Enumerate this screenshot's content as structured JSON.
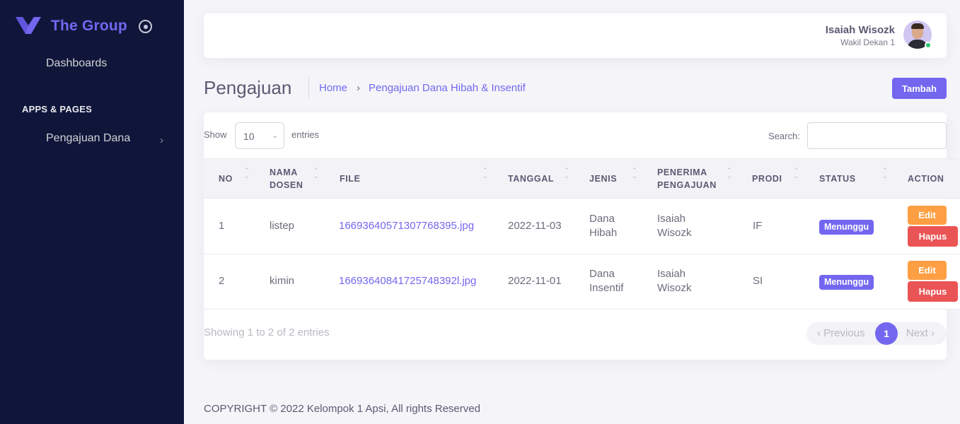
{
  "brand": {
    "name": "The Group",
    "color": "#7367f0"
  },
  "sidebar": {
    "dashboards": "Dashboards",
    "section": "APPS & PAGES",
    "pengajuan": "Pengajuan Dana"
  },
  "user": {
    "name": "Isaiah Wisozk",
    "role": "Wakil Dekan 1"
  },
  "page": {
    "title": "Pengajuan",
    "breadcrumb_home": "Home",
    "breadcrumb_sep": "›",
    "breadcrumb_current": "Pengajuan Dana Hibah & Insentif",
    "add_button": "Tambah"
  },
  "table_controls": {
    "show": "Show",
    "entries_value": "10",
    "entries": "entries",
    "search": "Search:"
  },
  "columns": {
    "no": "NO",
    "nama1": "NAMA",
    "nama2": "DOSEN",
    "file": "FILE",
    "tanggal": "TANGGAL",
    "jenis": "JENIS",
    "penerima1": "PENERIMA",
    "penerima2": "PENGAJUAN",
    "prodi": "PRODI",
    "status": "STATUS",
    "action": "ACTION"
  },
  "rows": [
    {
      "no": "1",
      "nama": "listep",
      "file": "16693640571307768395.jpg",
      "tanggal": "2022-11-03",
      "jenis1": "Dana",
      "jenis2": "Hibah",
      "penerima1": "Isaiah",
      "penerima2": "Wisozk",
      "prodi": "IF",
      "status": "Menunggu",
      "edit": "Edit",
      "hapus": "Hapus"
    },
    {
      "no": "2",
      "nama": "kimin",
      "file": "16693640841725748392l.jpg",
      "tanggal": "2022-11-01",
      "jenis1": "Dana",
      "jenis2": "Insentif",
      "penerima1": "Isaiah",
      "penerima2": "Wisozk",
      "prodi": "SI",
      "status": "Menunggu",
      "edit": "Edit",
      "hapus": "Hapus"
    }
  ],
  "pagination": {
    "info": "Showing 1 to 2 of 2 entries",
    "previous": "‹ Previous",
    "page": "1",
    "next": "Next ›"
  },
  "footer": "COPYRIGHT © 2022 Kelompok 1 Apsi, All rights Reserved",
  "colors": {
    "sidebar": "#10163a",
    "primary": "#7367f0",
    "warning": "#ff9f43",
    "danger": "#ea5455",
    "success": "#28c76f"
  }
}
